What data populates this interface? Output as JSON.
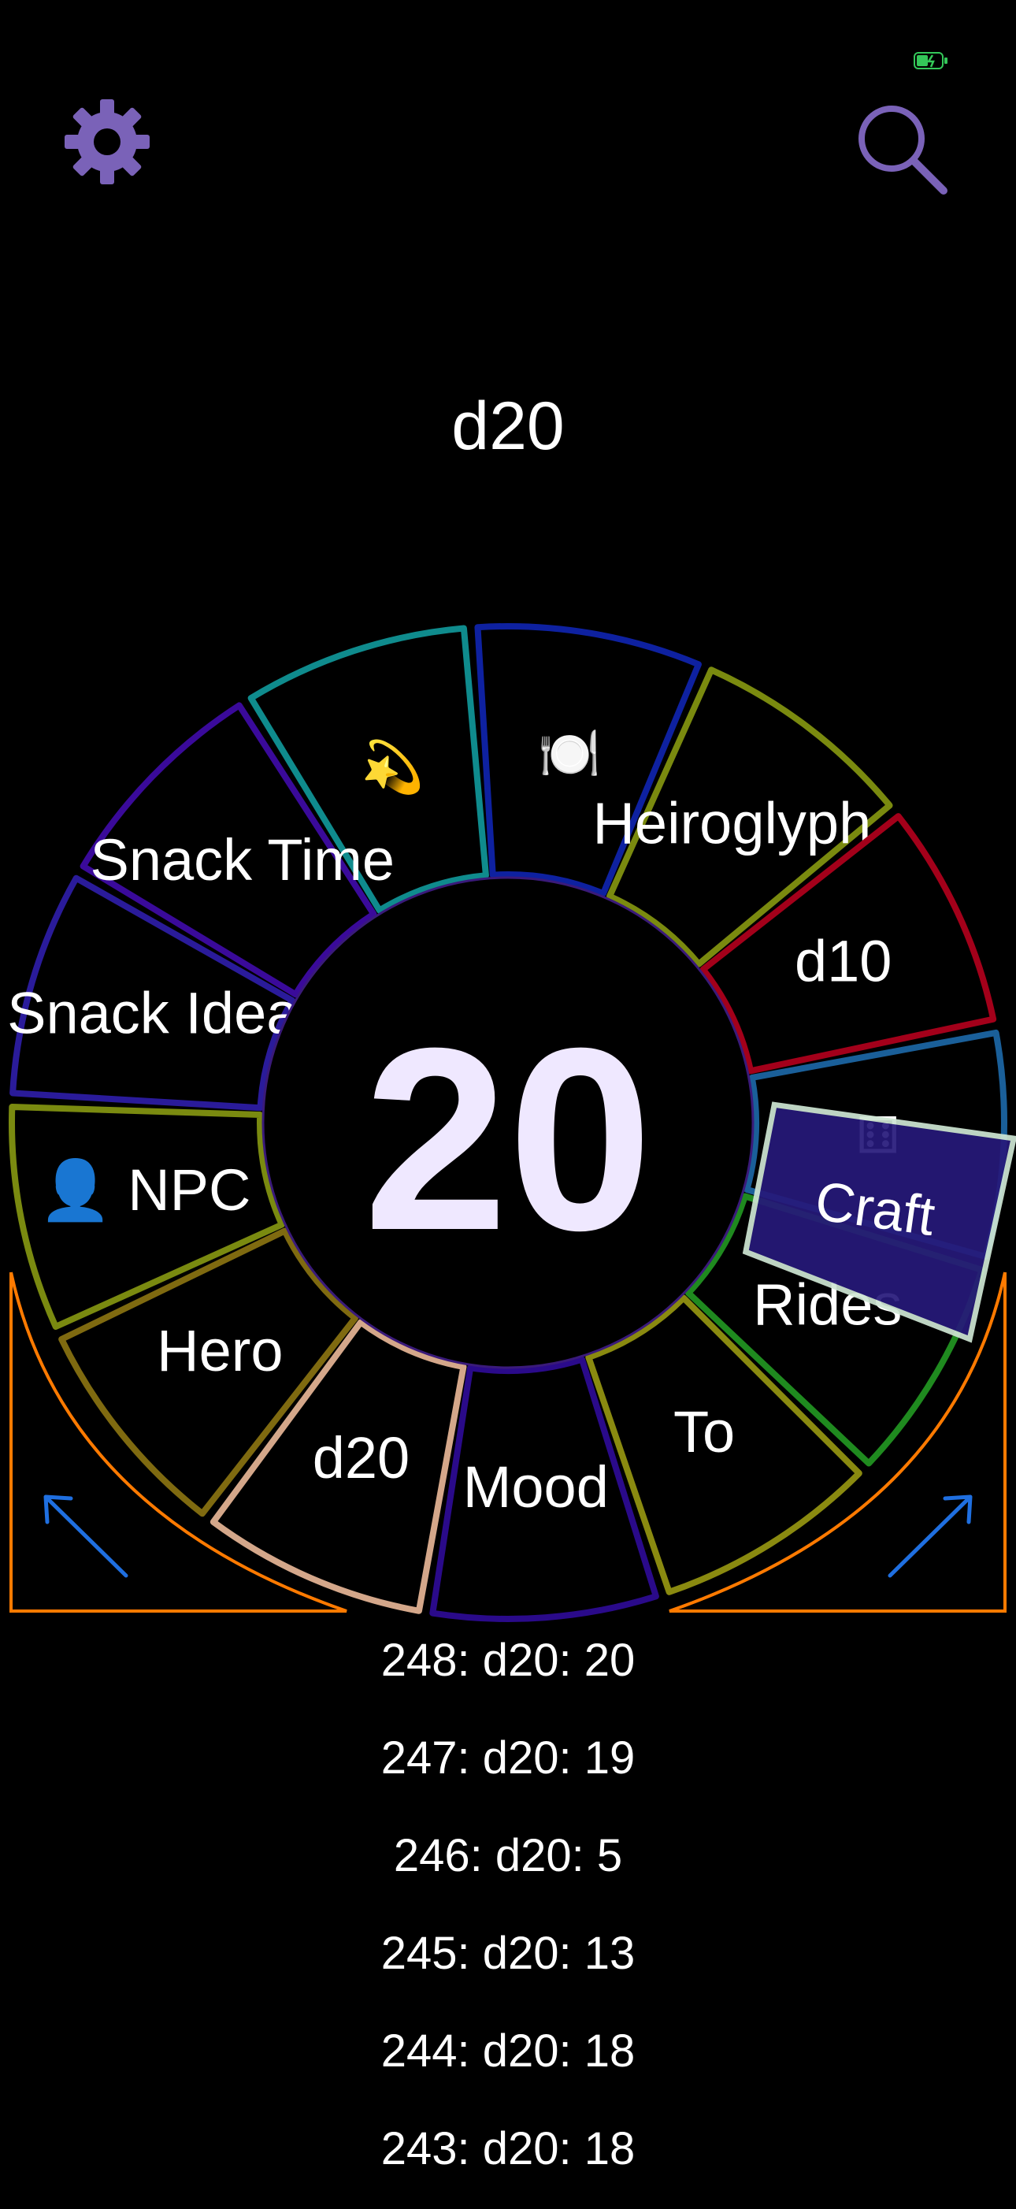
{
  "status_bar": {
    "battery_icon": "battery-charging-icon",
    "battery_color": "#34c759"
  },
  "toolbar": {
    "settings_icon": "gear-icon",
    "search_icon": "search-icon",
    "icon_color": "#7a62b8"
  },
  "current_die": "d20",
  "result": "20",
  "wheel": {
    "segments": [
      {
        "label": "💫",
        "color": "#0f8b8d"
      },
      {
        "label": "🍽️",
        "color": "#0e21a0"
      },
      {
        "label": "Heiroglyph",
        "color": "#7a8a0f"
      },
      {
        "label": "d10",
        "color": "#a3001a"
      },
      {
        "label": "⚅",
        "color": "#1a5f99"
      },
      {
        "label": "Rides",
        "color": "#1f8a1f"
      },
      {
        "label": "To",
        "color": "#8a8a10"
      },
      {
        "label": "Mood",
        "color": "#2a0a8a"
      },
      {
        "label": "d20",
        "color": "#d4a78a"
      },
      {
        "label": "Hero",
        "color": "#7f6a10"
      },
      {
        "label": "👤 NPC",
        "color": "#7a8a10"
      },
      {
        "label": "Snack Idea",
        "color": "#2a1b9a"
      },
      {
        "label": "Snack Time",
        "color": "#3a0a9a"
      }
    ],
    "dragged_tile": {
      "label": "Craft",
      "fill": "#26197a",
      "border": "#cfe6d4"
    },
    "rotate_left_icon": "rotate-counterclockwise-arrow-icon",
    "rotate_right_icon": "rotate-clockwise-arrow-icon",
    "corner_color": "#ff7a00",
    "arrow_color": "#1f6fe0"
  },
  "history": [
    {
      "text": "248: d20: 20"
    },
    {
      "text": "247: d20: 19"
    },
    {
      "text": "246: d20: 5"
    },
    {
      "text": "245: d20: 13"
    },
    {
      "text": "244: d20: 18"
    },
    {
      "text": "243: d20: 18"
    }
  ]
}
